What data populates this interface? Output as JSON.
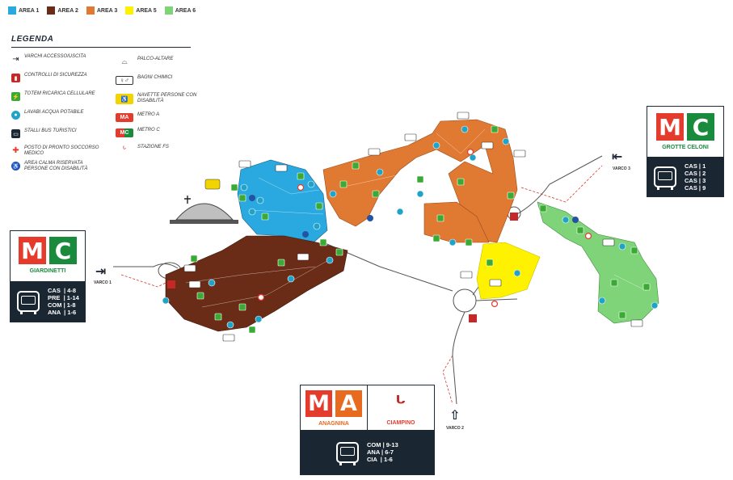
{
  "areas": [
    {
      "label": "AREA 1",
      "color": "#29a9e0"
    },
    {
      "label": "AREA 2",
      "color": "#6b2c17"
    },
    {
      "label": "AREA 3",
      "color": "#e07a33"
    },
    {
      "label": "AREA 5",
      "color": "#fff200"
    },
    {
      "label": "AREA 6",
      "color": "#7fd47a"
    }
  ],
  "legend": {
    "title": "LEGENDA",
    "items": [
      {
        "icon": "gate-arrow-icon",
        "text": "VARCHI ACCESSO/USCITA"
      },
      {
        "icon": "security-check-icon",
        "text": "CONTROLLI DI SICUREZZA"
      },
      {
        "icon": "phone-charging-icon",
        "text": "TOTEM RICARICA CELLULARE"
      },
      {
        "icon": "water-drop-icon",
        "text": "LAVABI ACQUA POTABILE"
      },
      {
        "icon": "tourist-bus-icon",
        "text": "STALLI BUS TURISTICI"
      },
      {
        "icon": "first-aid-icon",
        "text": "POSTO DI PRONTO SOCCORSO MEDICO"
      },
      {
        "icon": "accessible-icon",
        "text": "AREA CALMA RISERVATA PERSONE CON DISABILITÀ"
      },
      {
        "icon": "stage-altar-icon",
        "text": "PALCO-ALTARE"
      },
      {
        "icon": "toilets-icon",
        "text": "BAGNI CHIMICI"
      },
      {
        "icon": "shuttle-icon",
        "text": "NAVETTE PERSONE CON DISABILITÀ"
      },
      {
        "icon": "metro-a-icon",
        "text": "METRO A"
      },
      {
        "icon": "metro-c-icon",
        "text": "METRO C"
      },
      {
        "icon": "fs-station-icon",
        "text": "STAZIONE FS"
      }
    ]
  },
  "stations": {
    "giardinetti": {
      "name": "GIARDINETTI",
      "lines": [
        "CAS  | 4-8",
        "PRE  | 1-14",
        "COM | 1-8",
        "ANA  | 1-6"
      ]
    },
    "grotte_celoni": {
      "name": "GROTTE CELONI",
      "lines": [
        "CAS | 1",
        "CAS | 2",
        "CAS | 3",
        "CAS | 9"
      ]
    },
    "anagnina": {
      "name": "ANAGNINA",
      "fs_name": "CIAMPINO",
      "lines": [
        "COM | 9-13",
        "ANA | 6-7",
        "CIA  | 1-6"
      ]
    }
  },
  "varchi": {
    "v1": "VARCO 1",
    "v2": "VARCO 2",
    "v3": "VARCO 3"
  },
  "tiles": {
    "m": "M",
    "c": "C",
    "a": "A"
  },
  "colors": {
    "dark": "#1b2633",
    "red": "#e53b2c",
    "green": "#1a8a3c"
  }
}
